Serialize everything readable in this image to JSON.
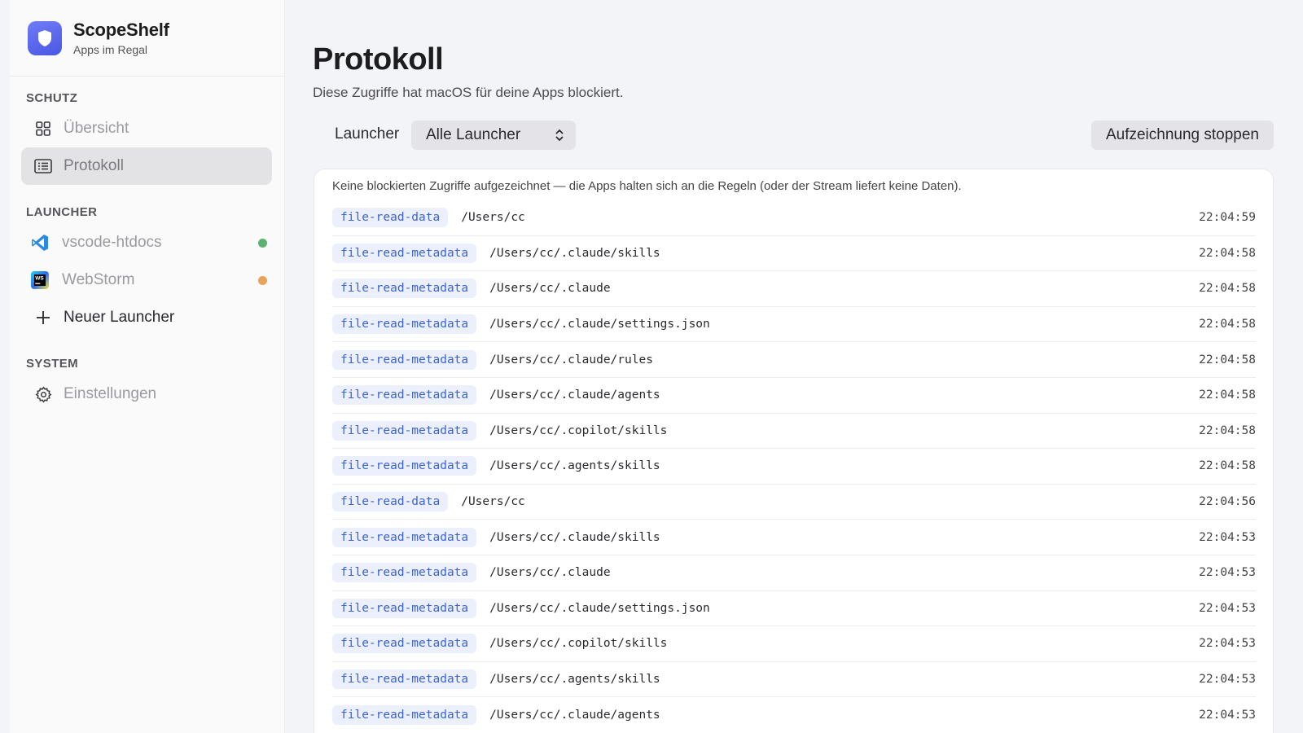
{
  "brand": {
    "name": "ScopeShelf",
    "subtitle": "Apps im Regal"
  },
  "sidebar": {
    "sections": [
      {
        "title": "SCHUTZ"
      },
      {
        "title": "LAUNCHER"
      },
      {
        "title": "SYSTEM"
      }
    ],
    "items": [
      {
        "label": "Übersicht",
        "icon": "grid-icon"
      },
      {
        "label": "Protokoll",
        "icon": "list-icon",
        "active": true
      },
      {
        "label": "vscode-htdocs",
        "icon": "vscode-icon",
        "status_color": "#5cb270"
      },
      {
        "label": "WebStorm",
        "icon": "webstorm-icon",
        "status_color": "#e8a25b"
      },
      {
        "label": "Neuer Launcher",
        "icon": "plus-icon"
      },
      {
        "label": "Einstellungen",
        "icon": "gear-icon"
      }
    ]
  },
  "main": {
    "title": "Protokoll",
    "subtitle": "Diese Zugriffe hat macOS für deine Apps blockiert.",
    "filter": {
      "label": "Launcher",
      "selected": "Alle Launcher"
    },
    "stop_button": "Aufzeichnung stoppen",
    "notice": "Keine blockierten Zugriffe aufgezeichnet — die Apps halten sich an die Regeln (oder der Stream liefert keine Daten).",
    "rows": [
      {
        "op": "file-read-data",
        "path": "/Users/cc",
        "time": "22:04:59"
      },
      {
        "op": "file-read-metadata",
        "path": "/Users/cc/.claude/skills",
        "time": "22:04:58"
      },
      {
        "op": "file-read-metadata",
        "path": "/Users/cc/.claude",
        "time": "22:04:58"
      },
      {
        "op": "file-read-metadata",
        "path": "/Users/cc/.claude/settings.json",
        "time": "22:04:58"
      },
      {
        "op": "file-read-metadata",
        "path": "/Users/cc/.claude/rules",
        "time": "22:04:58"
      },
      {
        "op": "file-read-metadata",
        "path": "/Users/cc/.claude/agents",
        "time": "22:04:58"
      },
      {
        "op": "file-read-metadata",
        "path": "/Users/cc/.copilot/skills",
        "time": "22:04:58"
      },
      {
        "op": "file-read-metadata",
        "path": "/Users/cc/.agents/skills",
        "time": "22:04:58"
      },
      {
        "op": "file-read-data",
        "path": "/Users/cc",
        "time": "22:04:56"
      },
      {
        "op": "file-read-metadata",
        "path": "/Users/cc/.claude/skills",
        "time": "22:04:53"
      },
      {
        "op": "file-read-metadata",
        "path": "/Users/cc/.claude",
        "time": "22:04:53"
      },
      {
        "op": "file-read-metadata",
        "path": "/Users/cc/.claude/settings.json",
        "time": "22:04:53"
      },
      {
        "op": "file-read-metadata",
        "path": "/Users/cc/.copilot/skills",
        "time": "22:04:53"
      },
      {
        "op": "file-read-metadata",
        "path": "/Users/cc/.agents/skills",
        "time": "22:04:53"
      },
      {
        "op": "file-read-metadata",
        "path": "/Users/cc/.claude/agents",
        "time": "22:04:53"
      }
    ]
  }
}
